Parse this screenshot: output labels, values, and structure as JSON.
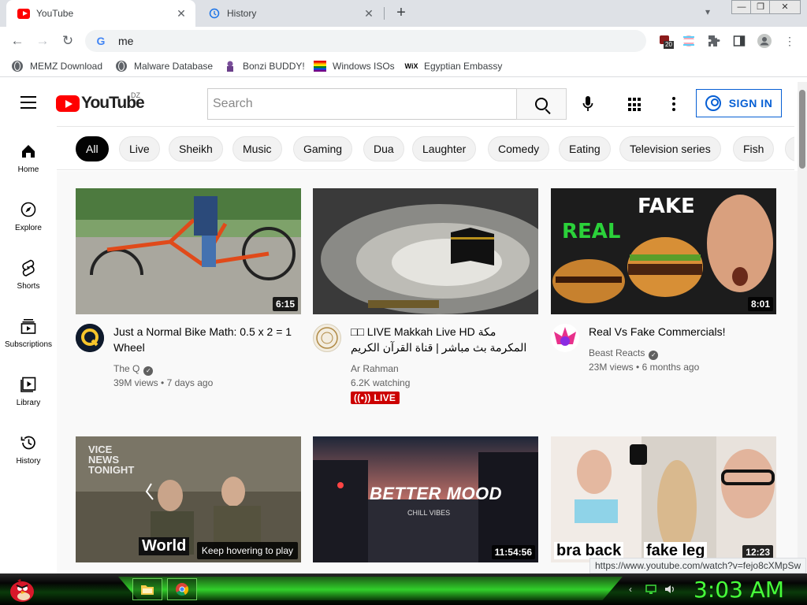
{
  "browser": {
    "tabs": [
      {
        "title": "YouTube",
        "icon": "youtube-icon",
        "active": true
      },
      {
        "title": "History",
        "icon": "history-icon",
        "active": false
      }
    ],
    "address": "me",
    "extension_badge": "20",
    "url_tooltip": "https://www.youtube.com/watch?v=fejo8cXMpSw"
  },
  "bookmarks": [
    {
      "label": "MEMZ Download",
      "icon": "globe-icon"
    },
    {
      "label": "Malware Database",
      "icon": "globe-icon"
    },
    {
      "label": "Bonzi BUDDY!",
      "icon": "bonzi-icon"
    },
    {
      "label": "Windows ISOs",
      "icon": "rainbow-flag-icon"
    },
    {
      "label": "Egyptian Embassy",
      "icon": "wix-icon"
    }
  ],
  "youtube": {
    "logo_text": "YouTube",
    "country_code": "DZ",
    "search_placeholder": "Search",
    "sign_in": "SIGN IN",
    "chips": [
      "All",
      "Live",
      "Sheikh",
      "Music",
      "Gaming",
      "Dua",
      "Laughter",
      "Comedy",
      "Eating",
      "Television series",
      "Fish"
    ],
    "sidebar": [
      {
        "label": "Home",
        "icon": "home-icon"
      },
      {
        "label": "Explore",
        "icon": "compass-icon"
      },
      {
        "label": "Shorts",
        "icon": "shorts-icon"
      },
      {
        "label": "Subscriptions",
        "icon": "subscriptions-icon"
      },
      {
        "label": "Library",
        "icon": "library-icon"
      },
      {
        "label": "History",
        "icon": "history-icon"
      }
    ],
    "videos": [
      {
        "title": "Just a Normal Bike Math: 0.5 x 2 = 1 Wheel",
        "channel": "The Q",
        "verified": true,
        "views": "39M views",
        "age": "7 days ago",
        "duration": "6:15",
        "live": false
      },
      {
        "title": "□□ LIVE Makkah Live HD مكة المكرمة بث مباشر | قناة القرآن الكريم | La...",
        "channel": "Ar Rahman",
        "verified": false,
        "views": "6.2K watching",
        "age": "",
        "duration": "",
        "live": true,
        "live_label": "LIVE"
      },
      {
        "title": "Real Vs Fake Commercials!",
        "channel": "Beast Reacts",
        "verified": true,
        "views": "23M views",
        "age": "6 months ago",
        "duration": "8:01",
        "live": false
      },
      {
        "title": "",
        "overlay": "Keep hovering to play",
        "thumb_text_1": "VICE NEWS TONIGHT",
        "thumb_text_2": "World",
        "duration": ""
      },
      {
        "title": "",
        "thumb_text_1": "BETTER MOOD",
        "thumb_text_2": "CHILL VIBES",
        "duration": "11:54:56"
      },
      {
        "title": "",
        "thumb_text_1": "bra back",
        "thumb_text_2": "fake leg",
        "duration": "12:23"
      }
    ],
    "thumb_text_fake": "FAKE",
    "thumb_text_real": "REAL"
  },
  "taskbar": {
    "clock": "3:03 AM"
  }
}
